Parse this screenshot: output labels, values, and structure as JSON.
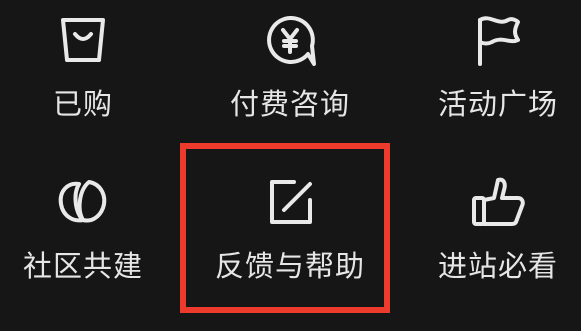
{
  "menu": {
    "items": [
      {
        "label": "已购",
        "icon": "shopping-bag-icon"
      },
      {
        "label": "付费咨询",
        "icon": "yen-chat-icon"
      },
      {
        "label": "活动广场",
        "icon": "flag-icon"
      },
      {
        "label": "社区共建",
        "icon": "community-icon"
      },
      {
        "label": "反馈与帮助",
        "icon": "edit-icon",
        "highlighted": true
      },
      {
        "label": "进站必看",
        "icon": "thumbs-up-icon"
      }
    ]
  },
  "colors": {
    "background": "#161616",
    "icon_stroke": "#e9e9e9",
    "highlight_border": "#ec3a2c"
  }
}
